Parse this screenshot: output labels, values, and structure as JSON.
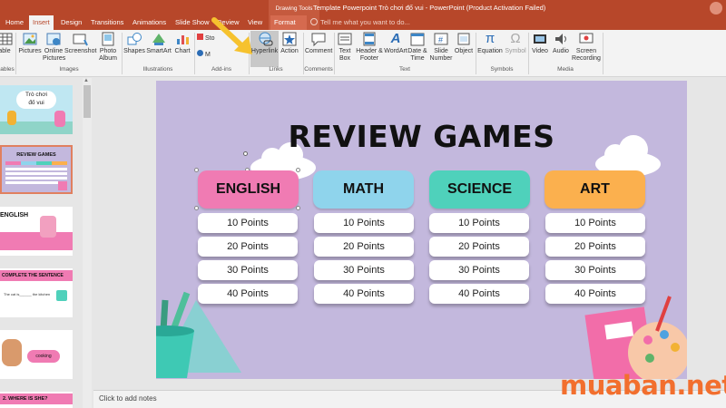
{
  "tabs": {
    "home": "Home",
    "insert": "Insert",
    "design": "Design",
    "transitions": "Transitions",
    "animations": "Animations",
    "slideshow": "Slide Show",
    "review": "Review",
    "view": "View",
    "format": "Format",
    "drawing_tools": "Drawing Tools"
  },
  "window_title": "Template Powerpoint Trò chơi đố vui - PowerPoint (Product Activation Failed)",
  "tell_me": "Tell me what you want to do...",
  "ribbon": {
    "table": "able",
    "pictures": "Pictures",
    "online_pictures": "Online Pictures",
    "screenshot": "Screenshot",
    "photo_album": "Photo Album",
    "shapes": "Shapes",
    "smartart": "SmartArt",
    "chart": "Chart",
    "store": "Sto",
    "myaddins": "M",
    "hyperlink": "Hyperlink",
    "action": "Action",
    "comment": "Comment",
    "textbox": "Text Box",
    "header_footer": "Header & Footer",
    "wordart": "WordArt",
    "date_time": "Date & Time",
    "slide_number": "Slide Number",
    "object": "Object",
    "equation": "Equation",
    "symbol": "Symbol",
    "video": "Video",
    "audio": "Audio",
    "screen_recording": "Screen Recording",
    "groups": {
      "tables": "ables",
      "images": "Images",
      "illustrations": "Illustrations",
      "addins": "Add-ins",
      "links": "Links",
      "comments": "Comments",
      "text": "Text",
      "symbols": "Symbols",
      "media": "Media"
    }
  },
  "thumbnails": {
    "t1_line1": "Trò chơi",
    "t1_line2": "đố vui",
    "t2": "REVIEW GAMES",
    "t3": "ENGLISH",
    "t4": "COMPLETE THE SENTENCE",
    "t4_sub": "The cat is______ the kitchen",
    "t5": "cooking",
    "t6": "2. WHERE IS SHE?"
  },
  "slide": {
    "title": "REVIEW GAMES",
    "categories": [
      "ENGLISH",
      "MATH",
      "SCIENCE",
      "ART"
    ],
    "points": [
      "10 Points",
      "20 Points",
      "30 Points",
      "40 Points"
    ]
  },
  "notes_placeholder": "Click to add notes",
  "watermark": "muaban.net",
  "colors": {
    "ribbon_accent": "#b7472a",
    "english": "#f07bb3",
    "math": "#8fd4ec",
    "science": "#4fd1bb",
    "art": "#fbb04e",
    "slide_bg": "#c3b8dd",
    "watermark": "#f26f2e"
  }
}
